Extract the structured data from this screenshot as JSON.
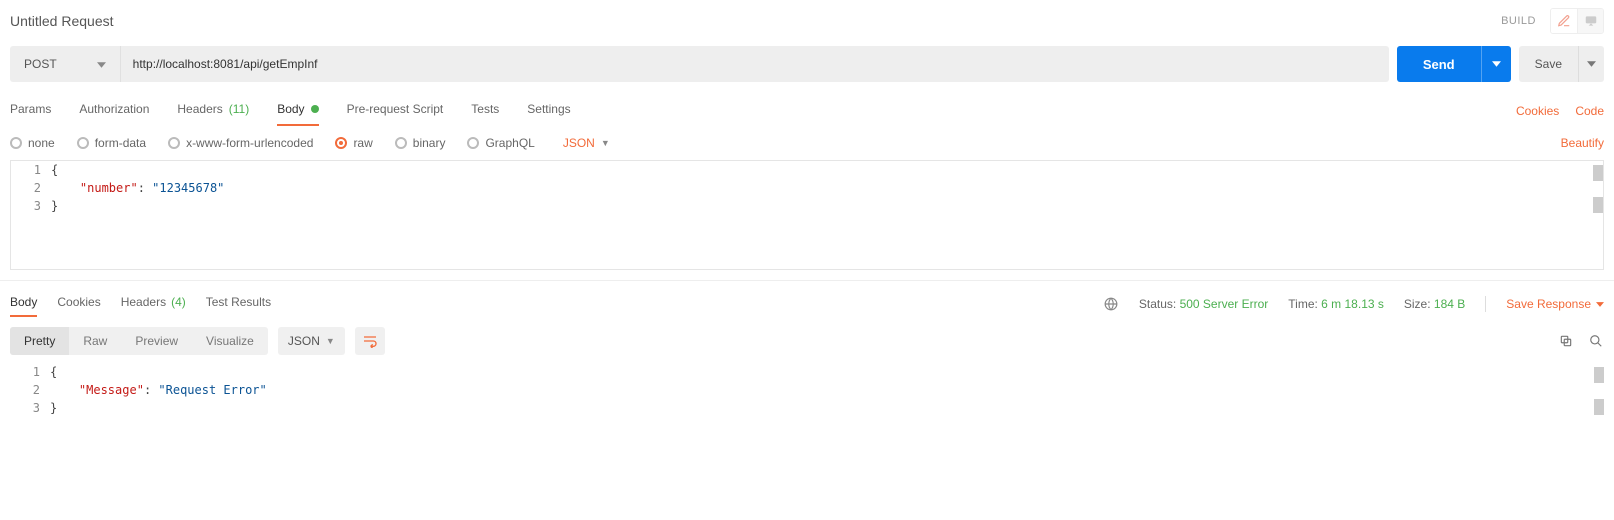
{
  "header": {
    "title": "Untitled Request",
    "build": "BUILD"
  },
  "request": {
    "method": "POST",
    "url": "http://localhost:8081/api/getEmpInf",
    "send": "Send",
    "save": "Save"
  },
  "reqTabs": {
    "params": "Params",
    "authorization": "Authorization",
    "headers": "Headers",
    "headers_count": "(11)",
    "body": "Body",
    "prerequest": "Pre-request Script",
    "tests": "Tests",
    "settings": "Settings",
    "cookies": "Cookies",
    "code": "Code"
  },
  "bodyTypes": {
    "none": "none",
    "formdata": "form-data",
    "urlencoded": "x-www-form-urlencoded",
    "raw": "raw",
    "binary": "binary",
    "graphql": "GraphQL",
    "format": "JSON",
    "beautify": "Beautify"
  },
  "reqBody": {
    "l1": "{",
    "l2_indent": "    ",
    "l2_key": "\"number\"",
    "l2_colon": ": ",
    "l2_val": "\"12345678\"",
    "l3": "}"
  },
  "respTabs": {
    "body": "Body",
    "cookies": "Cookies",
    "headers": "Headers",
    "headers_count": "(4)",
    "testresults": "Test Results"
  },
  "respStatus": {
    "status_lbl": "Status:",
    "status_val": "500 Server Error",
    "time_lbl": "Time:",
    "time_val": "6 m 18.13 s",
    "size_lbl": "Size:",
    "size_val": "184 B",
    "save_response": "Save Response"
  },
  "respView": {
    "pretty": "Pretty",
    "raw": "Raw",
    "preview": "Preview",
    "visualize": "Visualize",
    "format": "JSON"
  },
  "respBody": {
    "l1": "{",
    "l2_indent": "    ",
    "l2_key": "\"Message\"",
    "l2_colon": ": ",
    "l2_val": "\"Request Error\"",
    "l3": "}"
  }
}
